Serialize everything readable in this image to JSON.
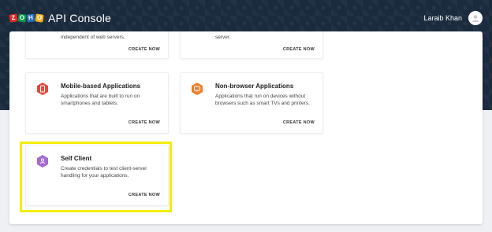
{
  "header": {
    "brand": "ZOHO",
    "logo_letters": [
      "Z",
      "O",
      "H",
      "O"
    ],
    "title": "API Console",
    "user_name": "Laraib Khan"
  },
  "cards": [
    {
      "title": "",
      "desc_visible": "independent of web servers.",
      "action": "CREATE NOW"
    },
    {
      "title": "",
      "desc_visible": "server.",
      "action": "CREATE NOW"
    },
    {
      "title": "Mobile-based Applications",
      "desc": "Applications that are built to run on smartphones and tablets.",
      "action": "CREATE NOW",
      "icon": "mobile-icon",
      "color": "#e8473a"
    },
    {
      "title": "Non-browser Applications",
      "desc": "Applications that run on devices without browsers such as smart TVs and printers.",
      "action": "CREATE NOW",
      "icon": "monitor-icon",
      "color": "#f07f2a"
    },
    {
      "title": "Self Client",
      "desc": "Create credentials to test client-server handling for your applications.",
      "action": "CREATE NOW",
      "icon": "user-icon",
      "color": "#a66bd3"
    }
  ],
  "colors": {
    "header_bg": "#1b2b3e",
    "highlight": "#f3ee00"
  }
}
